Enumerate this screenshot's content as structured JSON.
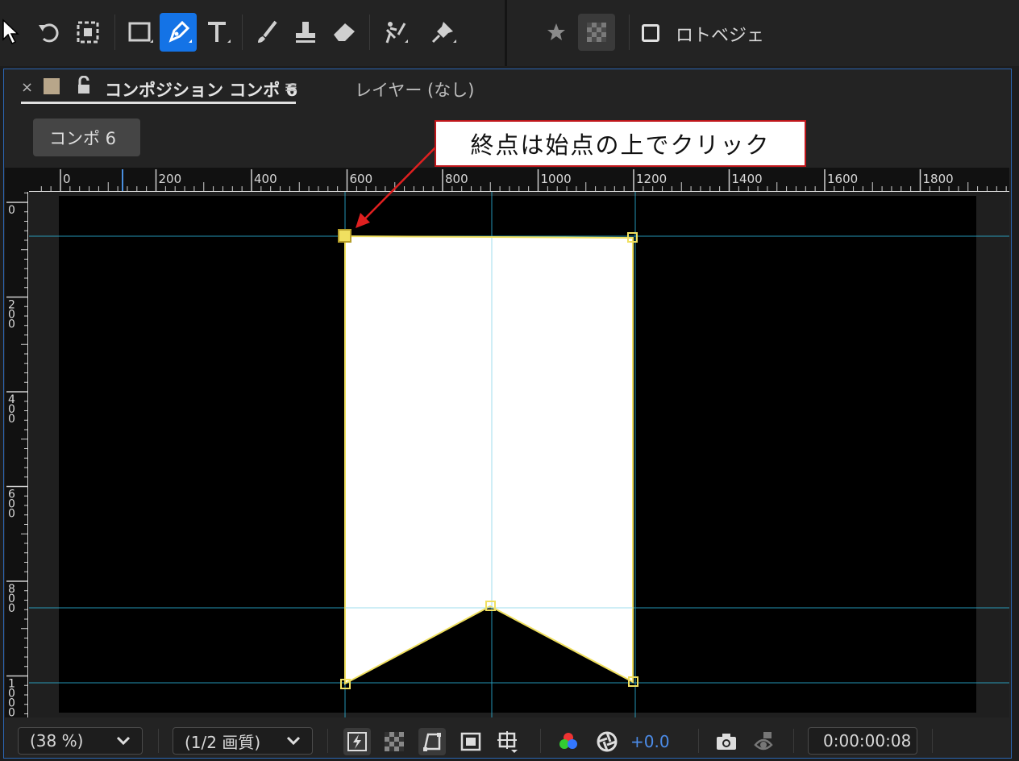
{
  "toolbar": {
    "tools": [
      "selection",
      "rotation",
      "anchor-point",
      "rectangle",
      "pen",
      "type",
      "brush",
      "clone-stamp",
      "eraser",
      "roto-brush",
      "puppet-pin"
    ],
    "active_tool": "pen",
    "roto_bezier_label": "ロトベジェ"
  },
  "panel": {
    "close_glyph": "×",
    "comp_tab_label": "コンポジション コンポ 6",
    "menu_glyph": "≡",
    "layer_tab_label": "レイヤー (なし)",
    "comp_button_label": "コンポ 6"
  },
  "ruler_h_ticks": [
    "0",
    "200",
    "400",
    "600",
    "800",
    "1000",
    "1200",
    "1400",
    "1600",
    "1800"
  ],
  "ruler_v_ticks": [
    "0",
    "200",
    "400",
    "600",
    "800",
    "1000"
  ],
  "callout": {
    "text": "終点は始点の上でクリック",
    "border_color": "#c0161b"
  },
  "bottom": {
    "zoom": "(38 %)",
    "resolution": "(1/2 画質)",
    "exposure": "+0.0",
    "timecode": "0:00:00:08"
  },
  "colors": {
    "accent": "#1473e6",
    "path": "#f0e060",
    "guide": "#2aa6c8",
    "label": "#b8a68a"
  }
}
